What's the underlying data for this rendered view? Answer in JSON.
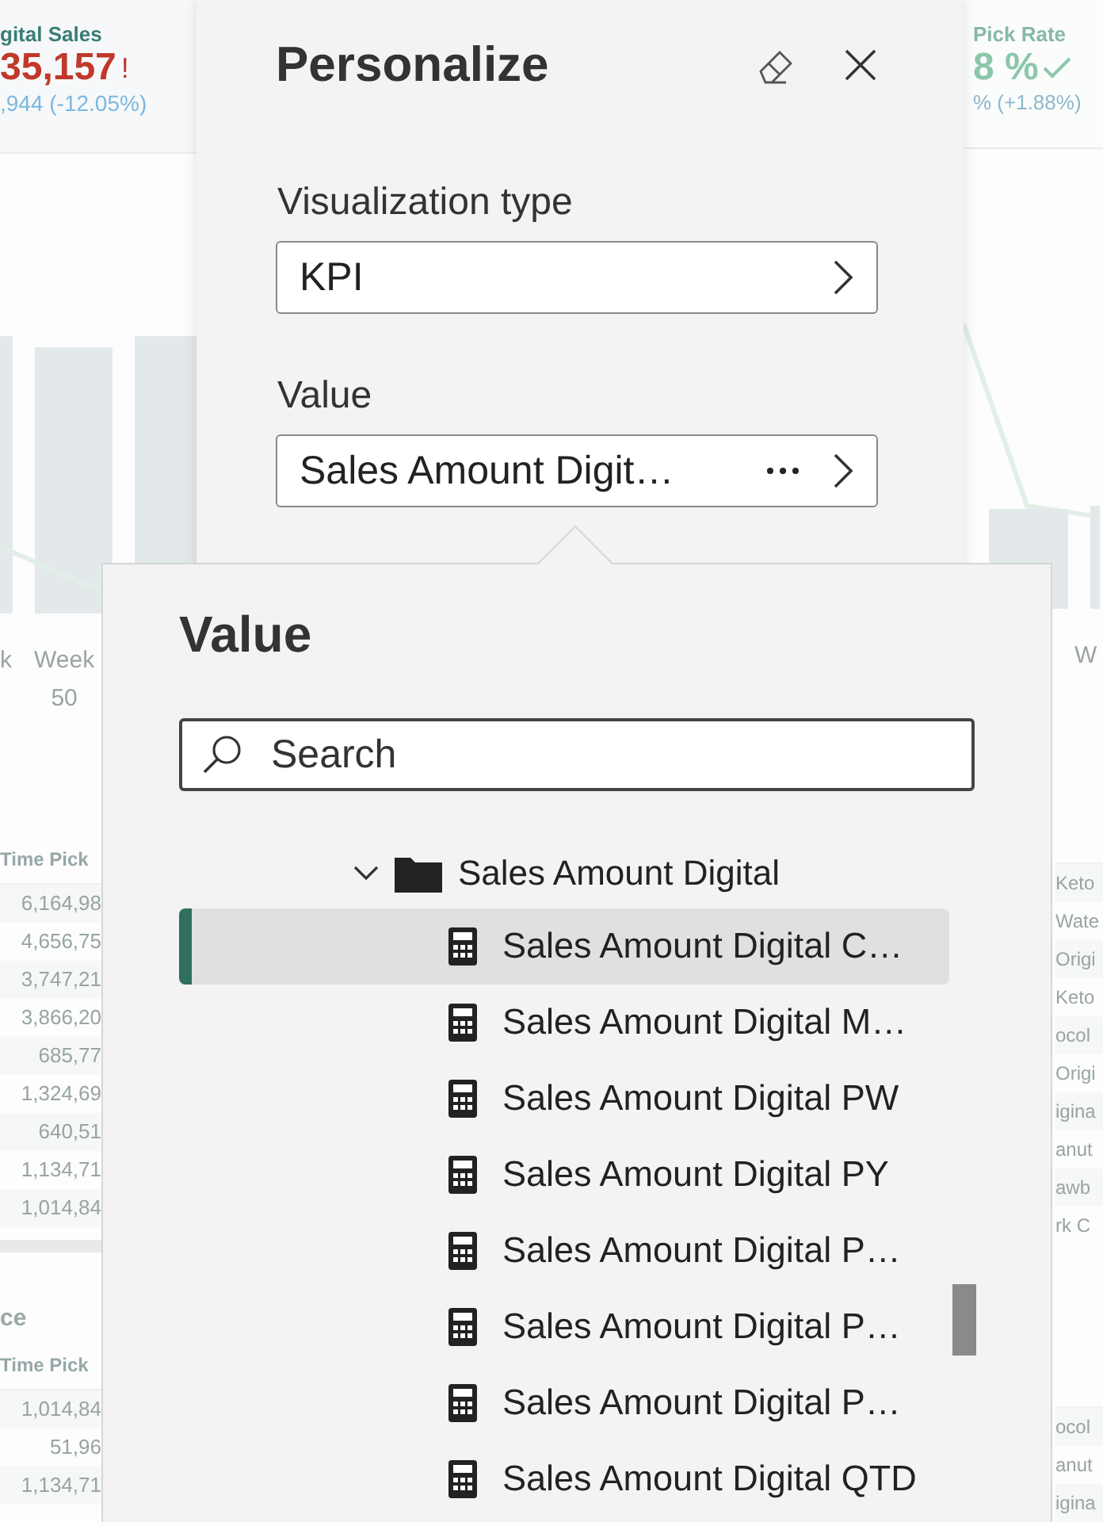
{
  "background": {
    "kpi_cards": [
      {
        "title": "gital Sales",
        "value": "35,157",
        "flag": "!",
        "comparison": ",944 (-12.05%)",
        "color": "#c0392b",
        "check": false
      },
      {
        "title": "Pick Rate",
        "value": "8 %",
        "comparison": "% (+1.88%)",
        "color": "#8cc7aa",
        "check": true
      }
    ],
    "chart_labels": {
      "left": [
        {
          "text": "k"
        },
        {
          "text": "Week\n50"
        }
      ],
      "right": [
        {
          "text": "W"
        }
      ]
    },
    "tables": [
      {
        "header": "Time Pick",
        "values": [
          "6,164,98",
          "4,656,75",
          "3,747,21",
          "3,866,20",
          "685,77",
          "1,324,69",
          "640,51",
          "1,134,71",
          "1,014,84"
        ],
        "names": [
          "Keto",
          "Wate",
          "Origi",
          "Keto",
          "ocol",
          "Origi",
          "igina",
          "anut",
          "awb",
          "rk C"
        ]
      },
      {
        "title": "ce",
        "header": "Time Pick",
        "values": [
          "1,014,84",
          "51,96",
          "1,134,71"
        ],
        "names": [
          "ocol",
          "anut",
          "igina"
        ]
      }
    ]
  },
  "panel": {
    "title": "Personalize",
    "fields": [
      {
        "label": "Visualization type",
        "value": "KPI",
        "more": false
      },
      {
        "label": "Value",
        "value": "Sales Amount Digit…",
        "more": true
      }
    ]
  },
  "popup": {
    "title": "Value",
    "search": {
      "placeholder": "Search"
    },
    "tree": [
      {
        "label": "Sales Amount Digital",
        "expanded": true,
        "children": [
          {
            "label": "Sales Amount Digital C…",
            "selected": true
          },
          {
            "label": "Sales Amount Digital M…",
            "selected": false
          },
          {
            "label": "Sales Amount Digital PW",
            "selected": false
          },
          {
            "label": "Sales Amount Digital PY",
            "selected": false
          },
          {
            "label": "Sales Amount Digital P…",
            "selected": false
          },
          {
            "label": "Sales Amount Digital P…",
            "selected": false
          },
          {
            "label": "Sales Amount Digital P…",
            "selected": false
          },
          {
            "label": "Sales Amount Digital QTD",
            "selected": false
          }
        ]
      }
    ]
  }
}
